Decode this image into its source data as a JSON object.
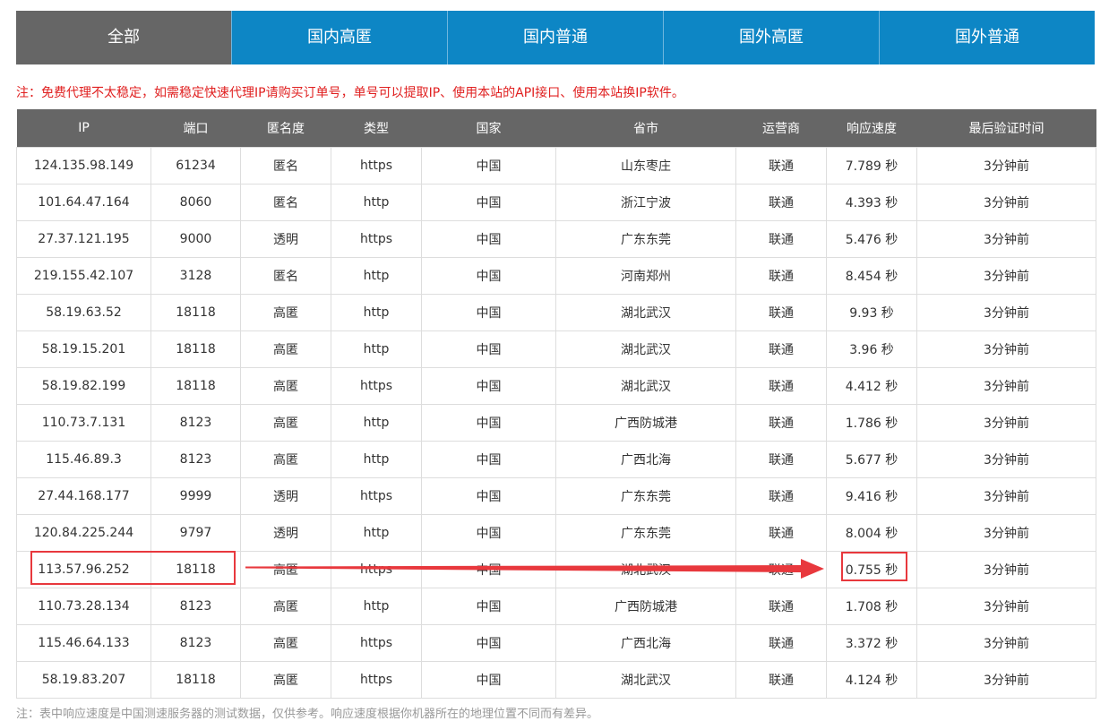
{
  "tabs": [
    "全部",
    "国内高匿",
    "国内普通",
    "国外高匿",
    "国外普通"
  ],
  "notice": "注：免费代理不太稳定，如需稳定快速代理IP请购买订单号，单号可以提取IP、使用本站的API接口、使用本站换IP软件。",
  "columns": [
    "IP",
    "端口",
    "匿名度",
    "类型",
    "国家",
    "省市",
    "运营商",
    "响应速度",
    "最后验证时间"
  ],
  "rows": [
    [
      "124.135.98.149",
      "61234",
      "匿名",
      "https",
      "中国",
      "山东枣庄",
      "联通",
      "7.789 秒",
      "3分钟前"
    ],
    [
      "101.64.47.164",
      "8060",
      "匿名",
      "http",
      "中国",
      "浙江宁波",
      "联通",
      "4.393 秒",
      "3分钟前"
    ],
    [
      "27.37.121.195",
      "9000",
      "透明",
      "https",
      "中国",
      "广东东莞",
      "联通",
      "5.476 秒",
      "3分钟前"
    ],
    [
      "219.155.42.107",
      "3128",
      "匿名",
      "http",
      "中国",
      "河南郑州",
      "联通",
      "8.454 秒",
      "3分钟前"
    ],
    [
      "58.19.63.52",
      "18118",
      "高匿",
      "http",
      "中国",
      "湖北武汉",
      "联通",
      "9.93 秒",
      "3分钟前"
    ],
    [
      "58.19.15.201",
      "18118",
      "高匿",
      "http",
      "中国",
      "湖北武汉",
      "联通",
      "3.96 秒",
      "3分钟前"
    ],
    [
      "58.19.82.199",
      "18118",
      "高匿",
      "https",
      "中国",
      "湖北武汉",
      "联通",
      "4.412 秒",
      "3分钟前"
    ],
    [
      "110.73.7.131",
      "8123",
      "高匿",
      "http",
      "中国",
      "广西防城港",
      "联通",
      "1.786 秒",
      "3分钟前"
    ],
    [
      "115.46.89.3",
      "8123",
      "高匿",
      "http",
      "中国",
      "广西北海",
      "联通",
      "5.677 秒",
      "3分钟前"
    ],
    [
      "27.44.168.177",
      "9999",
      "透明",
      "https",
      "中国",
      "广东东莞",
      "联通",
      "9.416 秒",
      "3分钟前"
    ],
    [
      "120.84.225.244",
      "9797",
      "透明",
      "http",
      "中国",
      "广东东莞",
      "联通",
      "8.004 秒",
      "3分钟前"
    ],
    [
      "113.57.96.252",
      "18118",
      "高匿",
      "https",
      "中国",
      "湖北武汉",
      "联通",
      "0.755 秒",
      "3分钟前"
    ],
    [
      "110.73.28.134",
      "8123",
      "高匿",
      "http",
      "中国",
      "广西防城港",
      "联通",
      "1.708 秒",
      "3分钟前"
    ],
    [
      "115.46.64.133",
      "8123",
      "高匿",
      "https",
      "中国",
      "广西北海",
      "联通",
      "3.372 秒",
      "3分钟前"
    ],
    [
      "58.19.83.207",
      "18118",
      "高匿",
      "https",
      "中国",
      "湖北武汉",
      "联通",
      "4.124 秒",
      "3分钟前"
    ]
  ],
  "footnote": "注：表中响应速度是中国测速服务器的测试数据，仅供参考。响应速度根据你机器所在的地理位置不同而有差异。",
  "colors": {
    "tab_active": "#666666",
    "tab": "#0d86c5",
    "header": "#666666",
    "notice": "#e02020",
    "annotation": "#e8383d"
  }
}
